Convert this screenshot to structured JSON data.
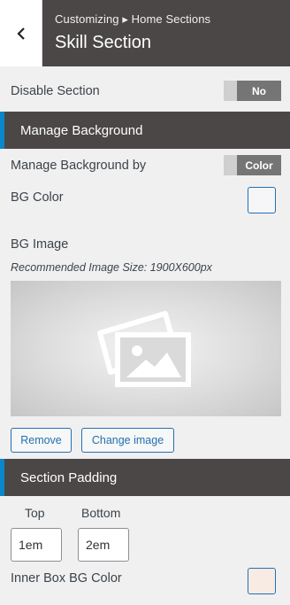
{
  "header": {
    "breadcrumb": "Customizing ▸ Home Sections",
    "title": "Skill Section"
  },
  "disable_section": {
    "label": "Disable Section",
    "value": "No"
  },
  "manage_background": {
    "heading": "Manage Background",
    "by_label": "Manage Background by",
    "by_value": "Color",
    "bg_color_label": "BG Color",
    "bg_color": "#f6f6f9",
    "bg_image_label": "BG Image",
    "bg_image_hint": "Recommended Image Size: 1900X600px",
    "remove_label": "Remove",
    "change_label": "Change image"
  },
  "section_padding": {
    "heading": "Section Padding",
    "top_label": "Top",
    "top_value": "1em",
    "bottom_label": "Bottom",
    "bottom_value": "2em",
    "inner_bg_label": "Inner Box BG Color",
    "inner_bg_color": "#f7ebe3"
  },
  "colors": {
    "accent": "#0a86c9",
    "header_bg": "#4a4746",
    "link": "#2271b1"
  }
}
